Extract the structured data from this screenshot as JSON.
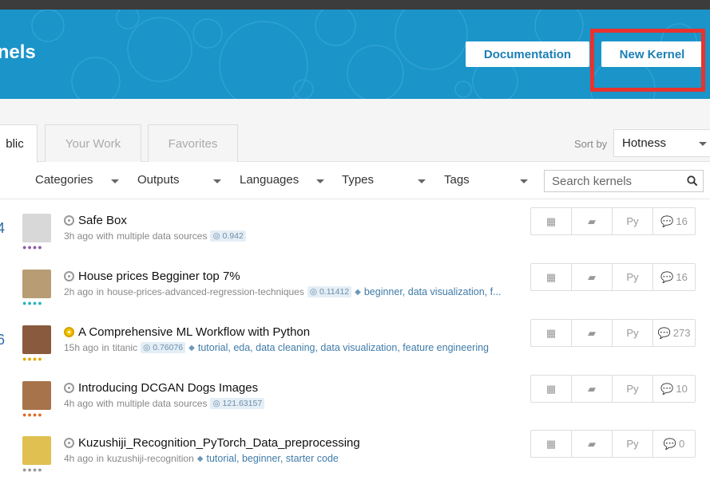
{
  "header": {
    "title": "ernels",
    "documentation_label": "Documentation",
    "new_kernel_label": "New Kernel"
  },
  "tabs": [
    {
      "label": "blic"
    },
    {
      "label": "Your Work"
    },
    {
      "label": "Favorites"
    }
  ],
  "sort": {
    "label": "Sort by",
    "value": "Hotness"
  },
  "filters": [
    {
      "label": "Categories"
    },
    {
      "label": "Outputs"
    },
    {
      "label": "Languages"
    },
    {
      "label": "Types"
    },
    {
      "label": "Tags"
    }
  ],
  "search": {
    "placeholder": "Search kernels"
  },
  "kernels": [
    {
      "rank": "4",
      "title": "Safe Box",
      "time": "3h ago",
      "source_prefix": "with",
      "source": "multiple data sources",
      "score": "0.942",
      "tags": "",
      "lang": "Py",
      "comments": "16",
      "medal": "none"
    },
    {
      "rank": "",
      "title": "House prices Begginer top 7%",
      "time": "2h ago",
      "source_prefix": "in",
      "source": "house-prices-advanced-regression-techniques",
      "score": "0.11412",
      "tags": "beginner, data visualization, f...",
      "lang": "Py",
      "comments": "16",
      "medal": "none"
    },
    {
      "rank": "6",
      "title": "A Comprehensive ML Workflow with Python",
      "time": "15h ago",
      "source_prefix": "in",
      "source": "titanic",
      "score": "0.76076",
      "tags": "tutorial, eda, data cleaning, data visualization, feature engineering",
      "lang": "Py",
      "comments": "273",
      "medal": "gold"
    },
    {
      "rank": "",
      "title": "Introducing DCGAN Dogs Images",
      "time": "4h ago",
      "source_prefix": "with",
      "source": "multiple data sources",
      "score": "121.63157",
      "tags": "",
      "lang": "Py",
      "comments": "10",
      "medal": "none"
    },
    {
      "rank": "",
      "title": "Kuzushiji_Recognition_PyTorch_Data_preprocessing",
      "time": "4h ago",
      "source_prefix": "in",
      "source": "kuzushiji-recognition",
      "score": "",
      "tags": "tutorial, beginner, starter code",
      "lang": "Py",
      "comments": "0",
      "medal": "none"
    }
  ],
  "colors": {
    "hero": "#1a94c9",
    "highlight": "#e8332e",
    "link": "#3f7ba8"
  }
}
